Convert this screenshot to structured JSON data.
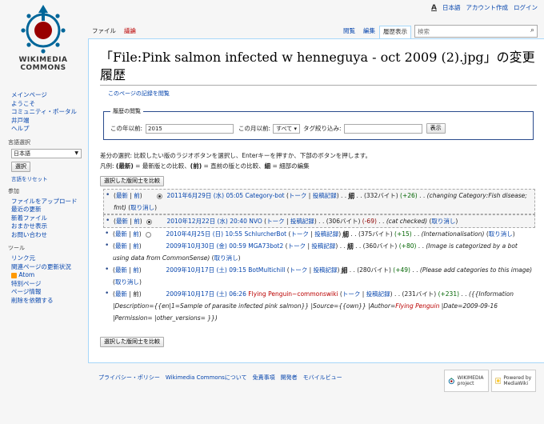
{
  "personal": {
    "lang_icon": "A",
    "language": "日本語",
    "create_account": "アカウント作成",
    "login": "ログイン"
  },
  "logo": {
    "line1": "WIKIMEDIA",
    "line2": "COMMONS"
  },
  "tabs": {
    "file": "ファイル",
    "talk": "議論",
    "read": "閲覧",
    "edit": "編集",
    "history": "履歴表示"
  },
  "search": {
    "placeholder": "検索"
  },
  "page": {
    "title": "「File:Pink salmon infected w henneguya - oct 2009 (2).jpg」の変更履歴",
    "log_link": "このページの記録を閲覧"
  },
  "browse": {
    "legend": "履歴の閲覧",
    "from_year_label": "この年以前:",
    "year_value": "2015",
    "from_month_label": "この月以前:",
    "month_value": "すべて",
    "tag_label": "タグ絞り込み:",
    "show_button": "表示"
  },
  "instructions": {
    "line1": "差分の選択: 比較したい版のラジオボタンを選択し、Enterキーを押すか、下部のボタンを押します。",
    "legend_prefix": "凡例: ",
    "cur": "(最新)",
    "cur_desc": " = 最新版との比較、",
    "prev": "(前)",
    "prev_desc": " = 直前の版との比較、",
    "minor": "細",
    "minor_desc": " = 細部の編集",
    "compare_button": "選択した版同士を比較"
  },
  "revisions": [
    {
      "cur": "最新",
      "prev": "前",
      "date": "2011年6月29日 (水) 05:05",
      "user": "Category-bot",
      "talk": "トーク",
      "contribs": "投稿記録",
      "minor": "細",
      "size": "(332バイト)",
      "diff": "(+26)",
      "summary": "(changing Category:Fish disease; fmt)",
      "undo": "取り消し"
    },
    {
      "cur": "最新",
      "prev": "前",
      "date": "2010年12月22日 (水) 20:40",
      "user": "NVO",
      "talk": "トーク",
      "contribs": "投稿記録",
      "size": "(306バイト)",
      "diff": "(-69)",
      "summary": "(cat checked)",
      "undo": "取り消し"
    },
    {
      "cur": "最新",
      "prev": "前",
      "date": "2010年4月25日 (日) 10:55",
      "user": "SchlurcherBot",
      "talk": "トーク",
      "contribs": "投稿記録",
      "minor": "細",
      "size": "(375バイト)",
      "diff": "(+15)",
      "summary": "(Internationalisation)",
      "undo": "取り消し"
    },
    {
      "cur": "最新",
      "prev": "前",
      "date": "2009年10月30日 (金) 00:59",
      "user": "MGA73bot2",
      "talk": "トーク",
      "contribs": "投稿記録",
      "minor": "細",
      "size": "(360バイト)",
      "diff": "(+80)",
      "summary": "(Image is categorized by a bot using data from CommonSense)",
      "undo": "取り消し"
    },
    {
      "cur": "最新",
      "prev": "前",
      "date": "2009年10月17日 (土) 09:15",
      "user": "BotMultichill",
      "talk": "トーク",
      "contribs": "投稿記録",
      "minor": "細",
      "size": "(280バイト)",
      "diff": "(+49)",
      "summary": "(Please add categories to this image)",
      "undo": "取り消し"
    },
    {
      "cur": "最新",
      "prev": "前",
      "date": "2009年10月17日 (土) 06:26",
      "user": "Flying Penguin~commonswiki",
      "talk": "トーク",
      "contribs": "投稿記録",
      "size": "(231バイト)",
      "diff": "(+231)",
      "summary_part1": "({{Information |Description={{en|1=Sample of parasite infected pink salmon}} |Source={{own}} |Author=",
      "summary_user": "Flying Penguin",
      "summary_part2": " |Date=2009-09-16 |Permission= |other_versions= }})"
    }
  ],
  "sidebar": {
    "main": [
      "メインページ",
      "ようこそ",
      "コミュニティ・ポータル",
      "井戸端",
      "ヘルプ"
    ],
    "lang_heading": "言語選択",
    "lang_value": "日本語",
    "lang_button": "選択",
    "lang_reset": "言語をリセット",
    "participate_heading": "参加",
    "participate": [
      "ファイルをアップロード",
      "最近の更新",
      "新着ファイル",
      "おまかせ表示",
      "お問い合わせ"
    ],
    "tools_heading": "ツール",
    "tools": [
      "リンク元",
      "関連ページの更新状況",
      "Atom",
      "特別ページ",
      "ページ情報",
      "削除を依頼する"
    ]
  },
  "footer": {
    "links": [
      "プライバシー・ポリシー",
      "Wikimedia Commonsについて",
      "免責事項",
      "開発者",
      "モバイルビュー"
    ],
    "badge_wikimedia": "WIKIMEDIA project",
    "badge_mediawiki": "Powered by MediaWiki"
  },
  "colors": {
    "link": "#0645ad",
    "red_link": "#ba0000",
    "positive": "#006400",
    "negative": "#8b0000",
    "border": "#a7d7f9"
  }
}
